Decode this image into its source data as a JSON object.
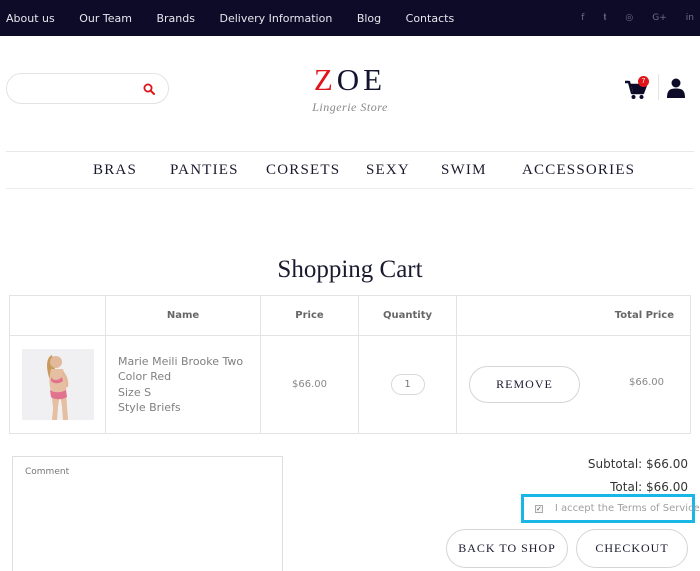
{
  "top_nav": {
    "links": [
      "About us",
      "Our Team",
      "Brands",
      "Delivery Information",
      "Blog",
      "Contacts"
    ],
    "social": [
      {
        "icon": "facebook-icon",
        "glyph": "f"
      },
      {
        "icon": "twitter-icon",
        "glyph": "𝕥"
      },
      {
        "icon": "instagram-icon",
        "glyph": "◎"
      },
      {
        "icon": "google-plus-icon",
        "glyph": "G+"
      },
      {
        "icon": "linkedin-icon",
        "glyph": "in"
      }
    ]
  },
  "header": {
    "search_placeholder": "",
    "logo_first": "Z",
    "logo_rest": "OE",
    "tagline": "Lingerie Store",
    "cart_count": "7"
  },
  "categories": [
    "BRAS",
    "PANTIES",
    "CORSETS",
    "SEXY",
    "SWIM",
    "ACCESSORIES"
  ],
  "page_title": "Shopping Cart",
  "table": {
    "headers": {
      "image": "",
      "name": "Name",
      "price": "Price",
      "quantity": "Quantity",
      "total": "Total Price"
    },
    "rows": [
      {
        "lines": [
          "Marie Meili Brooke Two",
          "Color Red",
          "Size S",
          "Style Briefs"
        ],
        "price": "$66.00",
        "quantity": "1",
        "remove_label": "REMOVE",
        "total": "$66.00"
      }
    ]
  },
  "summary": {
    "comment_placeholder": "Comment",
    "subtotal": "Subtotal: $66.00",
    "total": "Total: $66.00",
    "terms_label": "I accept the Terms of Service",
    "terms_checked": true
  },
  "buttons": {
    "back": "BACK TO SHOP",
    "checkout": "CHECKOUT"
  },
  "colors": {
    "topbar": "#0d0b28",
    "accent": "#e0151a",
    "highlight": "#19b6e8"
  }
}
